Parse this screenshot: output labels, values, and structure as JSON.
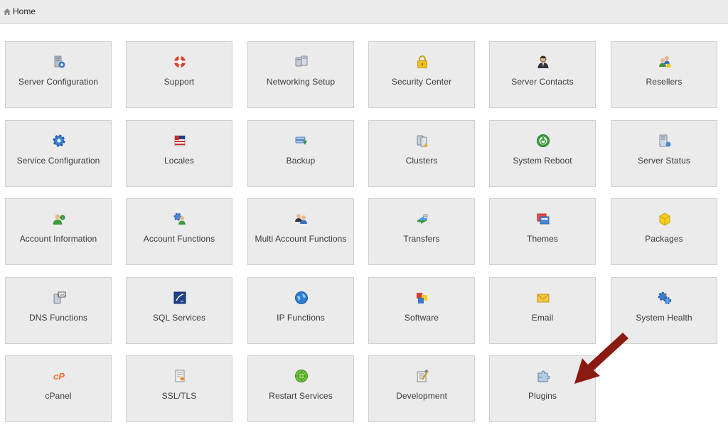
{
  "breadcrumb": {
    "home_label": "Home"
  },
  "tiles": [
    {
      "label": "Server Configuration",
      "icon": "server-config-icon"
    },
    {
      "label": "Support",
      "icon": "lifebuoy-icon"
    },
    {
      "label": "Networking Setup",
      "icon": "network-icon"
    },
    {
      "label": "Security Center",
      "icon": "padlock-icon"
    },
    {
      "label": "Server Contacts",
      "icon": "contact-person-icon"
    },
    {
      "label": "Resellers",
      "icon": "resellers-icon"
    },
    {
      "label": "Service Configuration",
      "icon": "gear-icon"
    },
    {
      "label": "Locales",
      "icon": "flag-icon"
    },
    {
      "label": "Backup",
      "icon": "backup-icon"
    },
    {
      "label": "Clusters",
      "icon": "cluster-icon"
    },
    {
      "label": "System Reboot",
      "icon": "power-icon"
    },
    {
      "label": "Server Status",
      "icon": "server-status-icon"
    },
    {
      "label": "Account Information",
      "icon": "account-info-icon"
    },
    {
      "label": "Account Functions",
      "icon": "account-functions-icon"
    },
    {
      "label": "Multi Account Functions",
      "icon": "multi-account-icon"
    },
    {
      "label": "Transfers",
      "icon": "transfer-icon"
    },
    {
      "label": "Themes",
      "icon": "themes-icon"
    },
    {
      "label": "Packages",
      "icon": "package-box-icon"
    },
    {
      "label": "DNS Functions",
      "icon": "dns-icon"
    },
    {
      "label": "SQL Services",
      "icon": "sql-icon"
    },
    {
      "label": "IP Functions",
      "icon": "globe-icon"
    },
    {
      "label": "Software",
      "icon": "software-cubes-icon"
    },
    {
      "label": "Email",
      "icon": "envelope-icon"
    },
    {
      "label": "System Health",
      "icon": "system-health-icon"
    },
    {
      "label": "cPanel",
      "icon": "cpanel-logo-icon"
    },
    {
      "label": "SSL/TLS",
      "icon": "certificate-icon"
    },
    {
      "label": "Restart Services",
      "icon": "restart-icon"
    },
    {
      "label": "Development",
      "icon": "development-icon"
    },
    {
      "label": "Plugins",
      "icon": "puzzle-icon"
    }
  ],
  "annotation": {
    "color": "#8b1a10"
  }
}
